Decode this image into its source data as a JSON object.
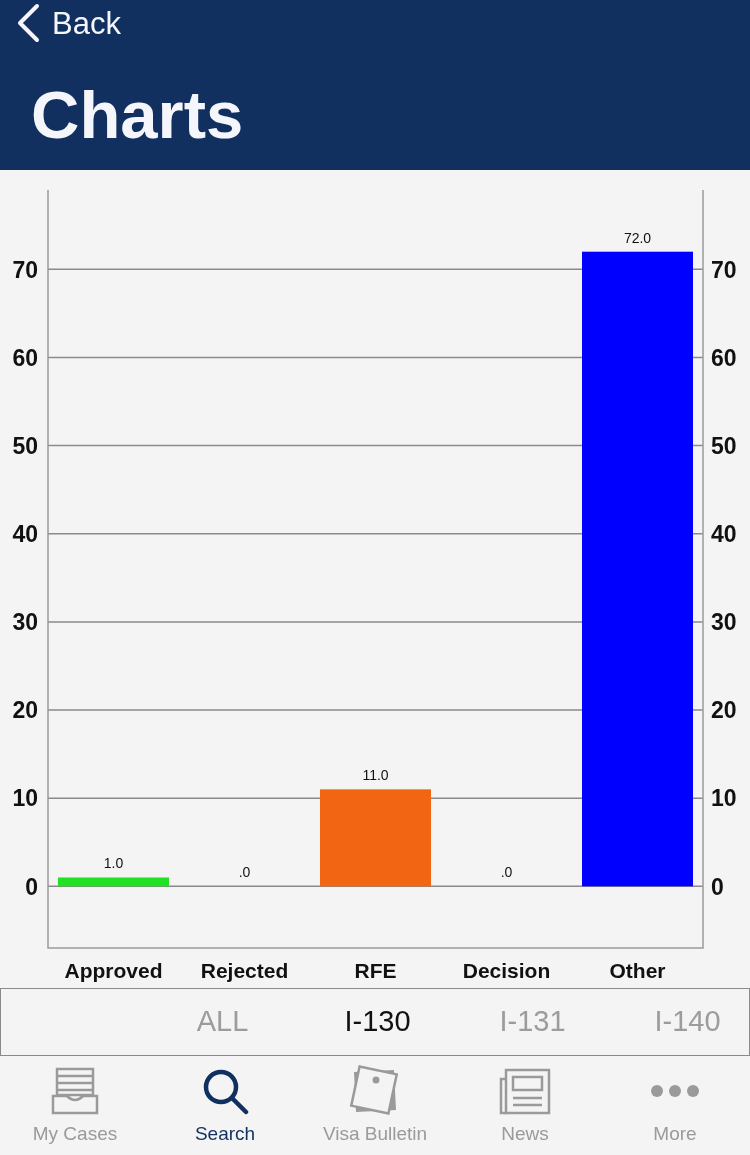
{
  "nav_bar": {
    "back_label": "Back",
    "title": "Charts"
  },
  "chart": {
    "left_axis_labels": [
      "70",
      "60",
      "50",
      "40",
      "30",
      "20",
      "10",
      "0"
    ],
    "chart_data": {
      "type": "bar",
      "categories": [
        "Approved",
        "Rejected",
        "RFE",
        "Decision",
        "Other"
      ],
      "values": [
        1,
        0,
        11,
        0,
        72
      ],
      "colors": [
        "#22e022",
        null,
        "#f26513",
        null,
        "#0000ff"
      ],
      "value_labels": [
        "1.0",
        ".0",
        "11.0",
        ".0",
        "72.0"
      ],
      "ylim": [
        -7,
        79
      ],
      "yticks": [
        70,
        60,
        50,
        40,
        30,
        20,
        10,
        0
      ],
      "grid": true
    },
    "right_axis_labels": [
      "70",
      "60",
      "50",
      "40",
      "30",
      "20",
      "10",
      "0"
    ]
  },
  "form_selector": [
    {
      "label": "ALL",
      "selected": false
    },
    {
      "label": "I-130",
      "selected": true
    },
    {
      "label": "I-131",
      "selected": false
    },
    {
      "label": "I-140",
      "selected": false
    }
  ],
  "tab_bar": [
    {
      "kind": "cases",
      "label": "My Cases",
      "selected": false
    },
    {
      "kind": "search",
      "label": "Search",
      "selected": true
    },
    {
      "kind": "bulletin",
      "label": "Visa Bulletin",
      "selected": false
    },
    {
      "kind": "news",
      "label": "News",
      "selected": false
    },
    {
      "kind": "more",
      "label": "More",
      "selected": false
    }
  ]
}
